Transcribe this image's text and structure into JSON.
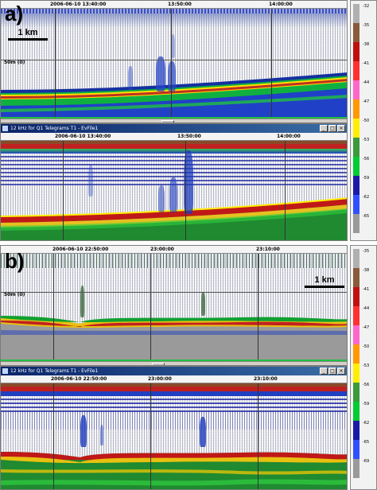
{
  "panel_a": {
    "label": "a)",
    "scale": "1 km",
    "depth_marker": "50m (0)",
    "top_times": [
      "2006-06-10 13:40:00",
      "13:50:00",
      "14:00:00"
    ],
    "window_title": "12 kHz for Q1 Telegrams T1 - EvFile1",
    "bottom_times": [
      "2006-06-10 13:40:00",
      "13:50:00",
      "14:00:00"
    ]
  },
  "panel_b": {
    "label": "b)",
    "scale": "1 km",
    "depth_marker": "50m (0)",
    "top_times": [
      "2006-06-10 22:50:00",
      "23:00:00",
      "23:10:00"
    ],
    "window_title": "12 kHz for Q1 Telegrams T1 - EvFile1",
    "bottom_times": [
      "2006-06-10 22:50:00",
      "23:00:00",
      "23:10:00"
    ]
  },
  "window_buttons": [
    "_",
    "□",
    "×"
  ],
  "legend_a": {
    "labels": [
      "-32",
      "-35",
      "-38",
      "-41",
      "-44",
      "-47",
      "-50",
      "-53",
      "-56",
      "-59",
      "-62",
      "-65"
    ],
    "colors": [
      "#b0b0b0",
      "#8a5a3a",
      "#c01010",
      "#ff3030",
      "#ff66cc",
      "#ff9900",
      "#ffee00",
      "#3c9a3c",
      "#00cc33",
      "#1a1aa8",
      "#3050ff",
      "#9a9a9a"
    ]
  },
  "legend_b": {
    "labels": [
      "-35",
      "-38",
      "-41",
      "-44",
      "-47",
      "-50",
      "-53",
      "-56",
      "-59",
      "-62",
      "-65",
      "-69"
    ],
    "colors": [
      "#b0b0b0",
      "#8a5a3a",
      "#c01010",
      "#ff3030",
      "#ff66cc",
      "#ff9900",
      "#ffee00",
      "#3c9a3c",
      "#00cc33",
      "#1a1aa8",
      "#3050ff",
      "#9a9a9a"
    ]
  }
}
